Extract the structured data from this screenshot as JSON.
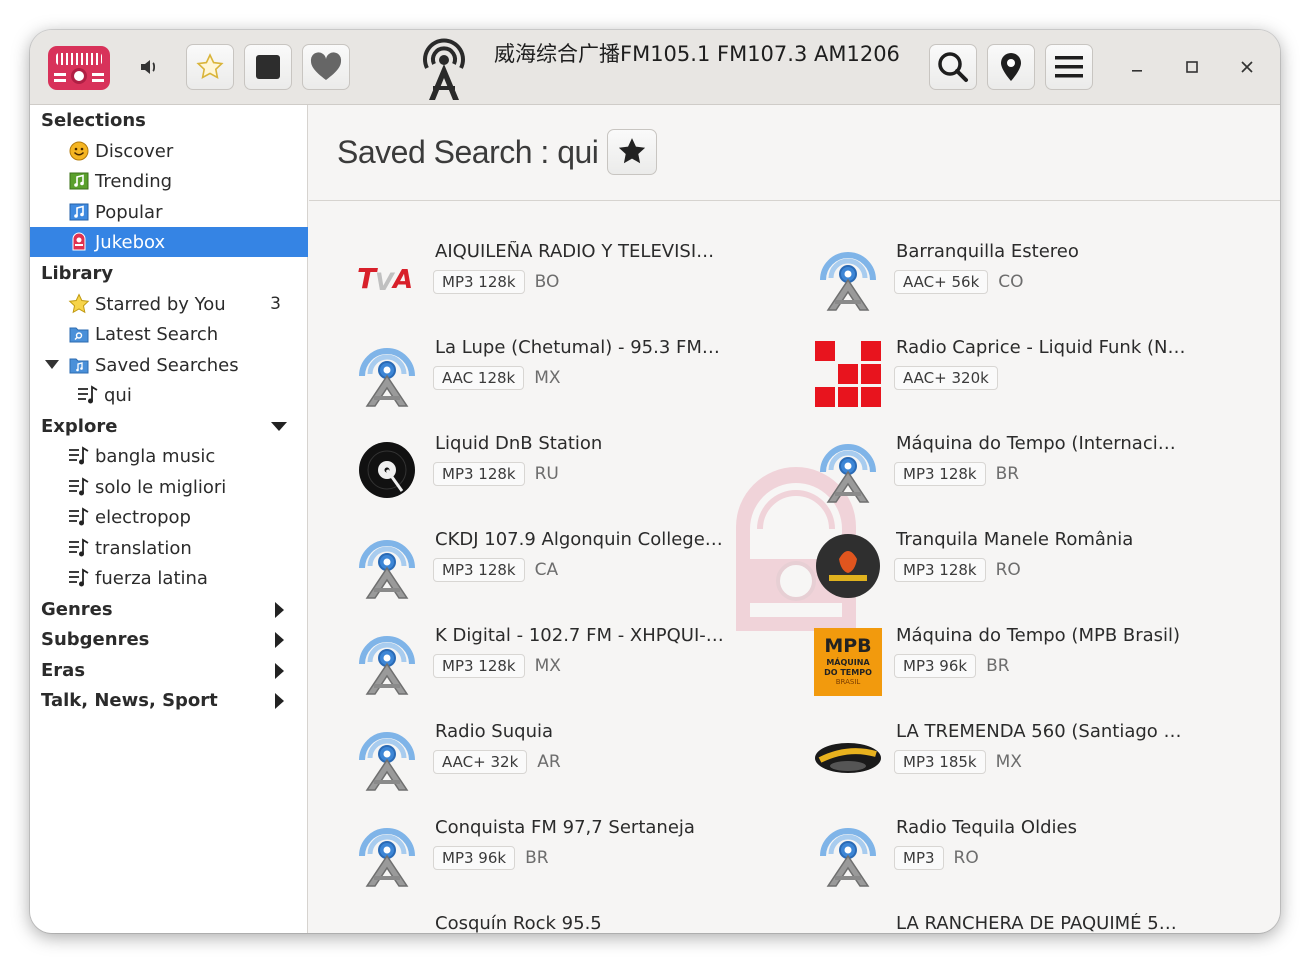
{
  "window": {
    "title": "威海综合广播FM105.1 FM107.3 AM1206"
  },
  "toolbar": {
    "app_icon": "radio-app-icon",
    "volume_icon": "speaker-icon",
    "star_icon": "star-outline-icon",
    "stop_icon": "stop-icon",
    "favorite_icon": "heart-icon",
    "station_icon": "antenna-icon",
    "search_icon": "search-icon",
    "location_icon": "map-pin-icon",
    "menu_icon": "hamburger-menu-icon"
  },
  "sidebar": {
    "selections_header": "Selections",
    "selections": [
      {
        "label": "Discover",
        "icon": "smiley-icon"
      },
      {
        "label": "Trending",
        "icon": "music-green-icon"
      },
      {
        "label": "Popular",
        "icon": "music-blue-icon"
      },
      {
        "label": "Jukebox",
        "icon": "jukebox-icon"
      }
    ],
    "library_header": "Library",
    "library": [
      {
        "label": "Starred by You",
        "icon": "star-icon",
        "count": "3"
      },
      {
        "label": "Latest Search",
        "icon": "search-folder-icon"
      },
      {
        "label": "Saved Searches",
        "icon": "music-folder-icon"
      },
      {
        "label": "qui",
        "icon": "playlist-icon"
      }
    ],
    "explore_header": "Explore",
    "explore": [
      {
        "label": "bangla music"
      },
      {
        "label": "solo le migliori"
      },
      {
        "label": "electropop"
      },
      {
        "label": "translation"
      },
      {
        "label": "fuerza latina"
      }
    ],
    "genres_header": "Genres",
    "subgenres_header": "Subgenres",
    "eras_header": "Eras",
    "talk_header": "Talk, News, Sport"
  },
  "main": {
    "title": "Saved Search : qui",
    "stations": [
      {
        "name": "AIQUILEÑA RADIO Y TELEVISI…",
        "codec": "MP3 128k",
        "country": "BO",
        "logo": "tva-logo"
      },
      {
        "name": "Barranquilla Estereo",
        "codec": "AAC+ 56k",
        "country": "CO",
        "logo": "antenna-logo"
      },
      {
        "name": "La Lupe (Chetumal) - 95.3 FM - …",
        "codec": "AAC 128k",
        "country": "MX",
        "logo": "antenna-logo"
      },
      {
        "name": "Radio Caprice - Liquid Funk (No…",
        "codec": "AAC+ 320k",
        "country": "",
        "logo": "caprice-logo"
      },
      {
        "name": "Liquid DnB Station",
        "codec": "MP3 128k",
        "country": "RU",
        "logo": "vinyl-logo"
      },
      {
        "name": "Máquina do Tempo (Internacio…",
        "codec": "MP3 128k",
        "country": "BR",
        "logo": "antenna-logo"
      },
      {
        "name": "CKDJ 107.9 Algonquin College…",
        "codec": "MP3 128k",
        "country": "CA",
        "logo": "antenna-logo"
      },
      {
        "name": "Tranquila Manele România",
        "codec": "MP3 128k",
        "country": "RO",
        "logo": "manele-logo"
      },
      {
        "name": "K Digital - 102.7 FM - XHPQUI-F…",
        "codec": "MP3 128k",
        "country": "MX",
        "logo": "antenna-logo"
      },
      {
        "name": "Máquina do Tempo (MPB Brasil)",
        "codec": "MP3 96k",
        "country": "BR",
        "logo": "mpb-logo"
      },
      {
        "name": "Radio Suquia",
        "codec": "AAC+ 32k",
        "country": "AR",
        "logo": "antenna-logo"
      },
      {
        "name": "LA TREMENDA 560 (Santiago …",
        "codec": "MP3 185k",
        "country": "MX",
        "logo": "tremenda-logo"
      },
      {
        "name": "Conquista FM 97,7 Sertaneja",
        "codec": "MP3 96k",
        "country": "BR",
        "logo": "antenna-logo"
      },
      {
        "name": "Radio Tequila Oldies",
        "codec": "MP3",
        "country": "RO",
        "logo": "antenna-logo"
      },
      {
        "name": "Cosquín Rock 95.5",
        "codec": "",
        "country": "",
        "logo": "cosquin-logo"
      },
      {
        "name": "LA RANCHERA DE PAQUIMÉ 5…",
        "codec": "",
        "country": "",
        "logo": "ranchera-logo"
      }
    ]
  },
  "colors": {
    "accent": "#3584e4",
    "logo_red": "#d8325a",
    "caprice_red": "#e8141e",
    "mpb_orange": "#f29a0d"
  }
}
